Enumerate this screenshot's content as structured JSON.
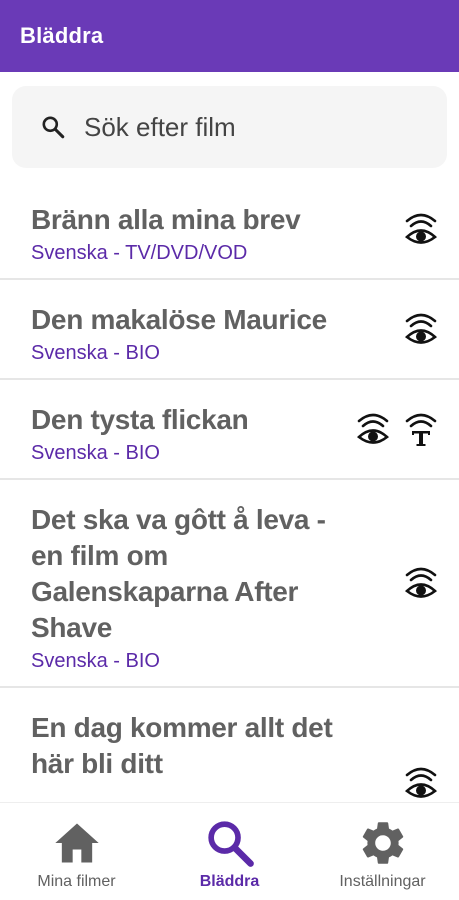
{
  "app_bar": {
    "title": "Bläddra"
  },
  "search": {
    "placeholder": "Sök efter film",
    "value": "",
    "icon": "search-icon"
  },
  "films": [
    {
      "title": "Bränn alla mina brev",
      "subtitle": "Svenska - TV/DVD/VOD",
      "icons": [
        "visual-interpretation-icon"
      ]
    },
    {
      "title": "Den makalöse Maurice",
      "subtitle": "Svenska - BIO",
      "icons": [
        "visual-interpretation-icon"
      ]
    },
    {
      "title": "Den tysta flickan",
      "subtitle": "Svenska - BIO",
      "icons": [
        "visual-interpretation-icon",
        "text-interpretation-icon"
      ]
    },
    {
      "title": "Det ska va gôtt å leva - en film om Galenskaparna After Shave",
      "subtitle": "Svenska - BIO",
      "icons": [
        "visual-interpretation-icon"
      ]
    },
    {
      "title": "En dag kommer allt det här bli ditt",
      "subtitle": "",
      "icons": [
        "visual-interpretation-icon"
      ]
    }
  ],
  "bottom_nav": {
    "items": [
      {
        "label": "Mina filmer",
        "icon": "home-icon",
        "active": false
      },
      {
        "label": "Bläddra",
        "icon": "search-icon",
        "active": true
      },
      {
        "label": "Inställningar",
        "icon": "gear-icon",
        "active": false
      }
    ]
  },
  "colors": {
    "primary": "#6a3ab7",
    "accent_text": "#5b2aa8",
    "title_text": "#616161",
    "divider": "#e6e6e6"
  }
}
